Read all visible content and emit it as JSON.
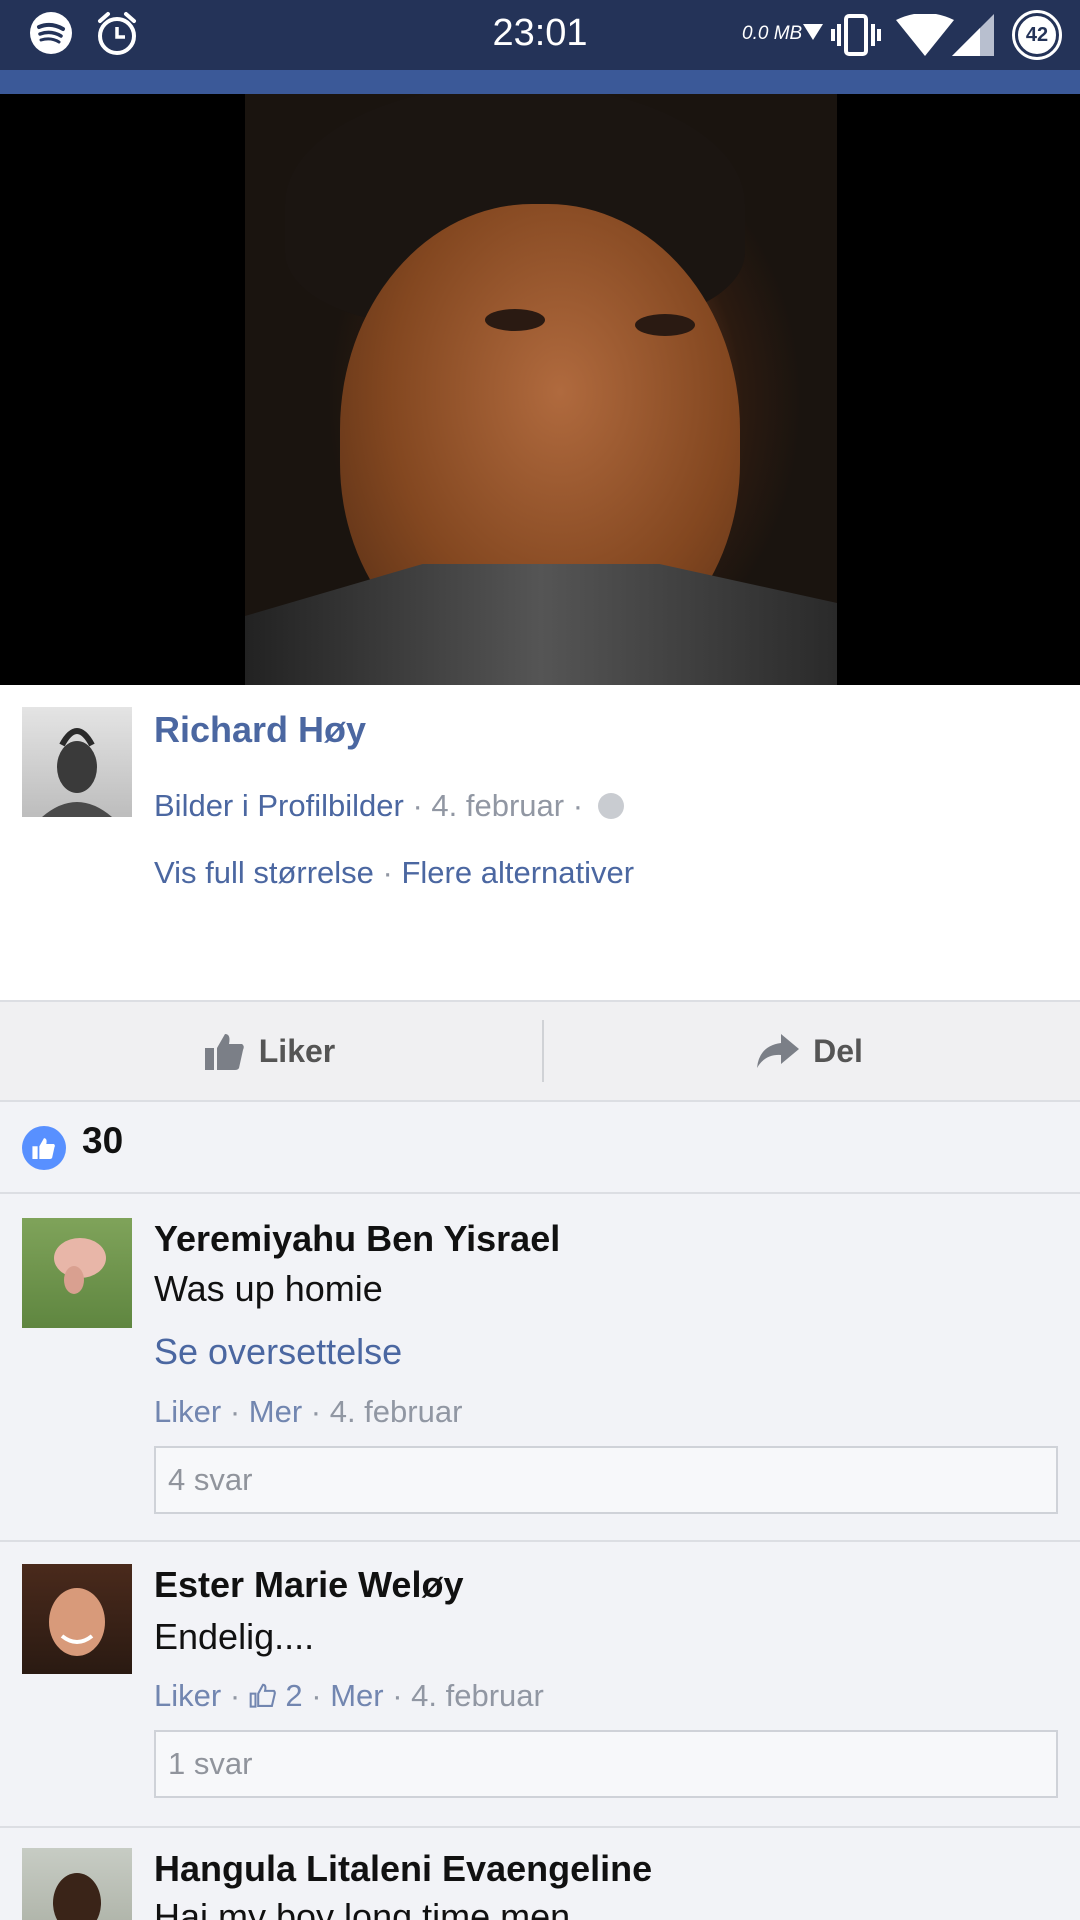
{
  "status_bar": {
    "time": "23:01",
    "data_rate": "0.0 MB",
    "battery": "42"
  },
  "post": {
    "author": "Richard Høy",
    "album_link": "Bilder i Profilbilder",
    "date": "4. februar",
    "view_full": "Vis full størrelse",
    "more_options": "Flere alternativer"
  },
  "actions": {
    "like": "Liker",
    "share": "Del"
  },
  "likes_count": "30",
  "comments": [
    {
      "name": "Yeremiyahu Ben Yisrael",
      "text": "Was up homie",
      "translate": "Se oversettelse",
      "like": "Liker",
      "more": "Mer",
      "date": "4. februar",
      "replies": "4 svar"
    },
    {
      "name": "Ester Marie Weløy",
      "text": "Endelig....",
      "like": "Liker",
      "like_count": "2",
      "more": "Mer",
      "date": "4. februar",
      "replies": "1 svar"
    },
    {
      "name": "Hangula Litaleni Evaengeline",
      "text": "Hai my boy long time men"
    }
  ]
}
